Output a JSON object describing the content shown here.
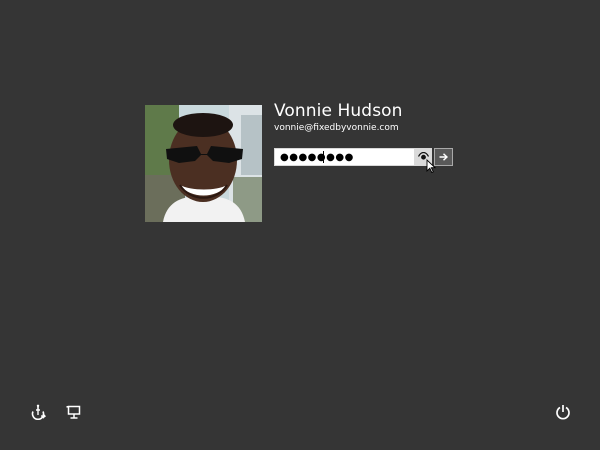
{
  "user": {
    "name": "Vonnie Hudson",
    "email": "vonnie@fixedbyvonnie.com"
  },
  "password_field": {
    "masked_value": "●●●●●●●●"
  },
  "icons": {
    "reveal": "eye-icon",
    "submit": "arrow-right-icon",
    "ease_of_access": "ease-of-access-icon",
    "display": "display-icon",
    "power": "power-icon"
  },
  "colors": {
    "background": "#353535",
    "text": "#ffffff",
    "submit_button": "#595959"
  }
}
